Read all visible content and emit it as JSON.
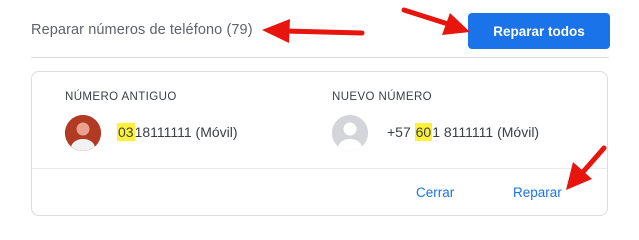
{
  "header": {
    "title": "Reparar números de teléfono (79)",
    "fix_all_label": "Reparar todos",
    "accent_color": "#1a73e8"
  },
  "card": {
    "old_header": "NÚMERO ANTIGUO",
    "new_header": "NUEVO NÚMERO",
    "old_number": {
      "highlight": "03",
      "rest": "18111111",
      "type": " (Móvil)"
    },
    "new_number": {
      "prefix": "+57 ",
      "highlight": "60",
      "rest": "1 8111111",
      "type": " (Móvil)"
    },
    "close_label": "Cerrar",
    "fix_label": "Reparar"
  },
  "annotations": {
    "arrow_color": "#e8140e",
    "highlight_color": "#fff13a"
  }
}
